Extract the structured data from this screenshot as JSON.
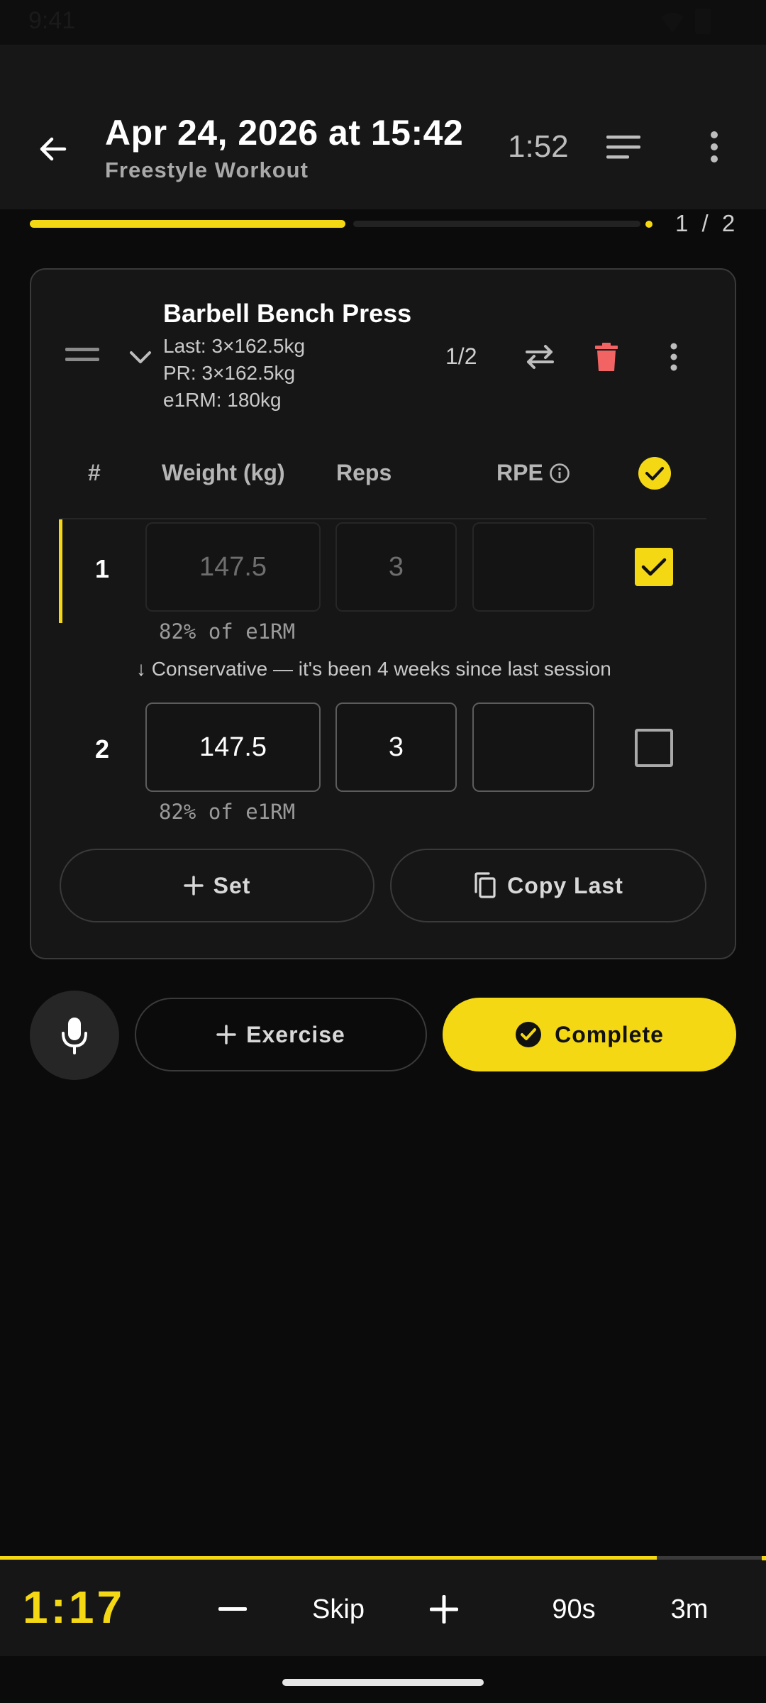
{
  "status_bar": {
    "time": "9:41"
  },
  "header": {
    "title": "Apr 24, 2026 at 15:42",
    "subtitle": "Freestyle Workout",
    "elapsed": "1:52"
  },
  "progress": {
    "text": "1 / 2",
    "fraction": 0.5
  },
  "exercise": {
    "name": "Barbell Bench Press",
    "last": "Last: 3×162.5kg",
    "pr": "PR: 3×162.5kg",
    "e1rm": "e1RM: 180kg",
    "counter": "1/2",
    "table_headers": {
      "number": "#",
      "weight": "Weight (kg)",
      "reps": "Reps",
      "rpe": "RPE"
    },
    "sets": [
      {
        "number": "1",
        "weight": "147.5",
        "reps": "3",
        "rpe": "",
        "percent": "82% of e1RM",
        "completed": true
      },
      {
        "number": "2",
        "weight": "147.5",
        "reps": "3",
        "rpe": "",
        "percent": "82% of e1RM",
        "completed": false
      }
    ],
    "advice": "↓ Conservative — it's been 4 weeks since last session",
    "add_set_label": "Set",
    "copy_last_label": "Copy Last"
  },
  "actions": {
    "add_exercise_label": "Exercise",
    "complete_label": "Complete"
  },
  "rest_timer": {
    "time": "1:17",
    "minus": "−",
    "skip": "Skip",
    "plus": "+",
    "preset_1": "90s",
    "preset_2": "3m",
    "fraction_remaining": 0.86
  },
  "colors": {
    "accent": "#f5d814",
    "danger": "#f26363",
    "background": "#0b0b0b",
    "card": "#161616"
  }
}
